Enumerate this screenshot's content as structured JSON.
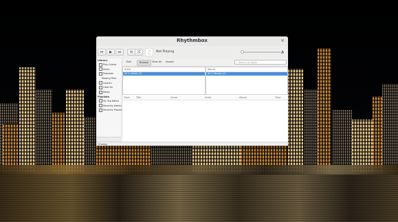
{
  "window": {
    "title": "Rhythmbox",
    "close_icon": "×"
  },
  "player": {
    "prev_icon": "⏮",
    "play_icon": "▶",
    "next_icon": "⏭",
    "repeat_icon": "⟲",
    "shuffle_icon": "⤮",
    "album_art_icon": "♫",
    "now_playing": "Not Playing",
    "volume_icon": "🔈",
    "seek_fraction": 0
  },
  "sidebar": {
    "library_heading": "Library",
    "library_items": [
      "Play Queue",
      "Music",
      "Podcasts",
      "Missing Files",
      "Last.fm",
      "Libre.fm",
      "Radio"
    ],
    "playlists_heading": "Playlists",
    "playlist_items": [
      "My Top Rated",
      "Recently Added",
      "Recently Played"
    ],
    "bottom_buttons": [
      "+",
      "-",
      "≡"
    ]
  },
  "tabs": [
    "Edit",
    "Browse",
    "View All",
    "Import"
  ],
  "active_tab": "Browse",
  "search": {
    "placeholder": "Search all fields"
  },
  "browser": {
    "artist_header": "Artist",
    "artist_selected": "All 0 artists (0)",
    "album_header": "Album",
    "album_selected": "All 0 albums (0)"
  },
  "tracklist": {
    "columns": [
      "Track",
      "Title",
      "Genre",
      "Artist",
      "Album",
      "Time"
    ]
  },
  "status": {
    "text": "0 songs"
  }
}
